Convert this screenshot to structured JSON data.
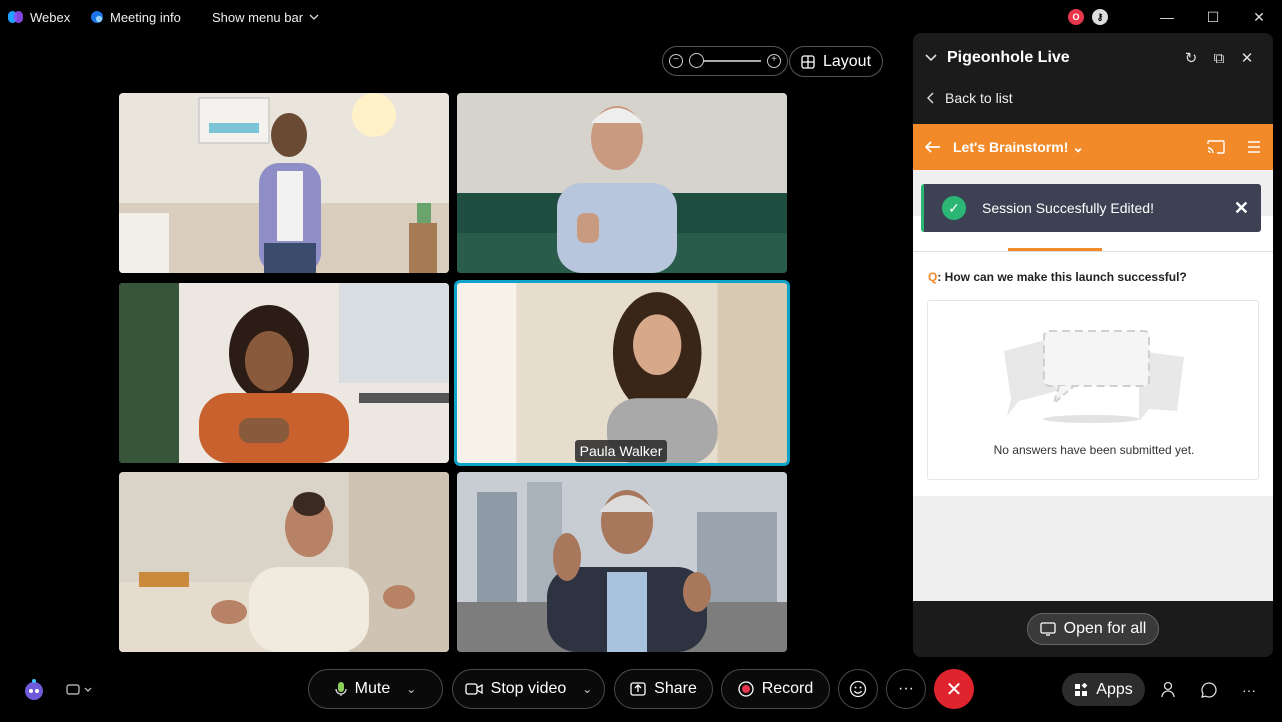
{
  "topbar": {
    "app_name": "Webex",
    "meeting_info": "Meeting info",
    "show_menu_bar": "Show menu bar",
    "status_badge": "O"
  },
  "zoom": {
    "level": 0
  },
  "layout_label": "Layout",
  "active_speaker_name": "Paula Walker",
  "panel": {
    "title": "Pigeonhole Live",
    "back_label": "Back to list",
    "session_title": "Let's Brainstorm!",
    "toast": "Session Succesfully Edited!",
    "question_prefix": "Q",
    "question": ": How can we make this launch successful?",
    "empty_message": "No answers have been submitted yet.",
    "open_for_all": "Open for all"
  },
  "controls": {
    "mute": "Mute",
    "stop_video": "Stop video",
    "share": "Share",
    "record": "Record",
    "apps": "Apps",
    "more": "···"
  },
  "colors": {
    "accent_orange": "#f28a2a",
    "active_tile": "#0fa3c9",
    "end_call": "#e0242e",
    "success": "#2bb673"
  }
}
